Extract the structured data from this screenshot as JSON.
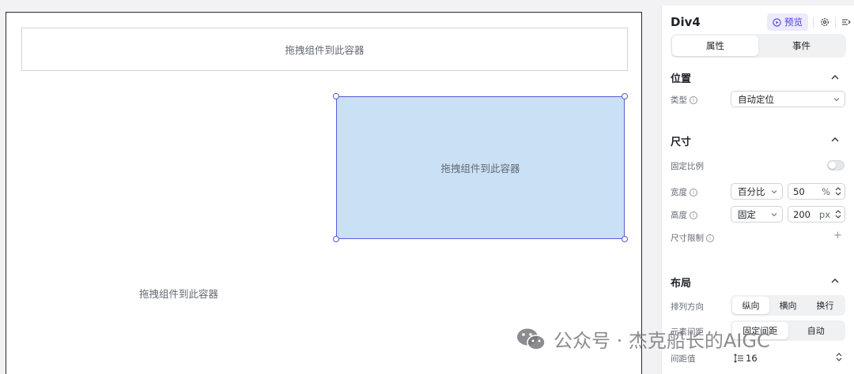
{
  "canvas": {
    "dropzone_top": "拖拽组件到此容器",
    "dropzone_selected": "拖拽组件到此容器",
    "dropzone_bottom": "拖拽组件到此容器"
  },
  "watermark": {
    "text": "公众号 · 杰克船长的AIGC"
  },
  "panel": {
    "title": "Div4",
    "preview_label": "预览",
    "tabs": [
      {
        "label": "属性",
        "active": true
      },
      {
        "label": "事件",
        "active": false
      }
    ],
    "position": {
      "title": "位置",
      "type_label": "类型",
      "type_value": "自动定位"
    },
    "size": {
      "title": "尺寸",
      "fixed_ratio_label": "固定比例",
      "fixed_ratio_on": false,
      "width_label": "宽度",
      "width_mode": "百分比",
      "width_value": "50",
      "width_unit": "%",
      "height_label": "高度",
      "height_mode": "固定",
      "height_value": "200",
      "height_unit": "px",
      "limit_label": "尺寸限制"
    },
    "layout": {
      "title": "布局",
      "direction_label": "排列方向",
      "direction_options": [
        "纵向",
        "横向",
        "换行"
      ],
      "direction_selected": "纵向",
      "spacing_label": "元素间距",
      "spacing_options": [
        "固定间距",
        "自动"
      ],
      "spacing_selected": "固定间距",
      "gap_label": "间距值",
      "gap_value": "16"
    }
  },
  "colors": {
    "accent": "#5b5bd6",
    "selected_fill": "#c9e0f5",
    "preview_bg": "#eceafd"
  }
}
